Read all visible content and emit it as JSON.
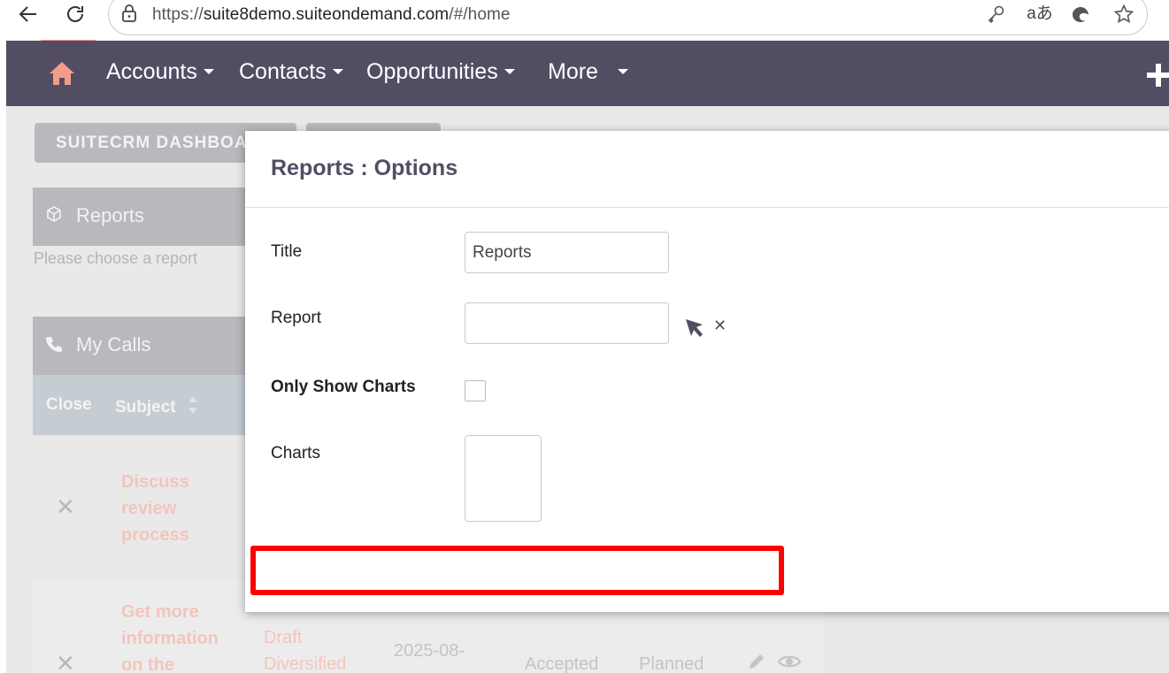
{
  "browser": {
    "url_scheme": "https://",
    "url_host": "suite8demo.suiteondemand.com",
    "url_path": "/#/home",
    "icons": [
      "back-icon",
      "refresh-icon",
      "lock-icon",
      "key-icon",
      "translate-icon",
      "edge-icon",
      "star-icon"
    ],
    "translate_glyph": "aあ"
  },
  "nav": {
    "items": [
      "Accounts",
      "Contacts",
      "Opportunities",
      "More"
    ]
  },
  "background": {
    "dashboard_tab": "SUITECRM DASHBOARD",
    "reports_dashlet_title": "Reports",
    "reports_hint": "Please choose a report",
    "calls_dashlet_title": "My Calls",
    "columns": {
      "close": "Close",
      "subject": "Subject"
    },
    "rows": [
      {
        "subject": "Discuss review process"
      },
      {
        "subject": "Get more information on the",
        "related": "Draft Diversified",
        "date": "2025-08-",
        "accept": "Accepted",
        "status": "Planned"
      }
    ]
  },
  "modal": {
    "title": "Reports : Options",
    "fields": {
      "title_label": "Title",
      "title_value": "Reports",
      "report_label": "Report",
      "report_value": "",
      "only_charts_label": "Only Show Charts",
      "only_charts_checked": false,
      "charts_label": "Charts"
    }
  },
  "colors": {
    "nav_bg": "#534d64",
    "accent": "#f29c8a",
    "highlight": "#ff0000"
  }
}
